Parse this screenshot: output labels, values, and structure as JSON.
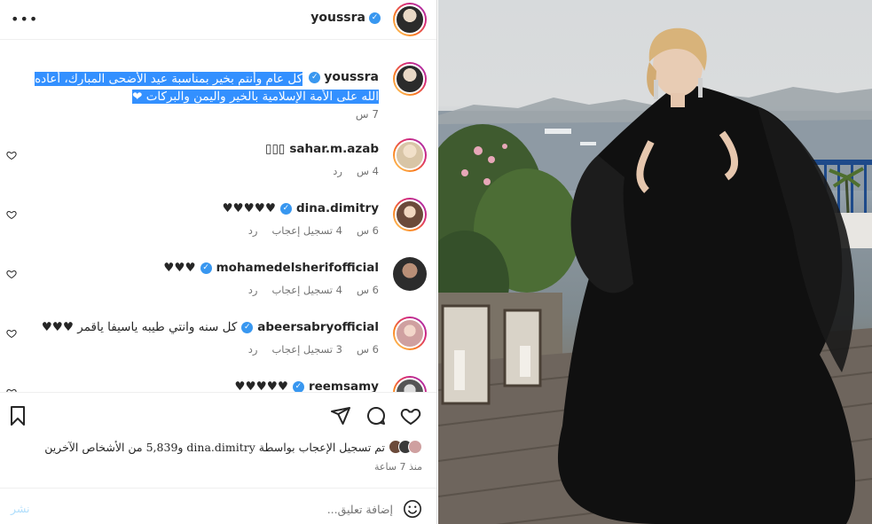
{
  "header": {
    "username": "youssra",
    "more_label": "•••"
  },
  "caption": {
    "username": "youssra",
    "text": "كل عام وأنتم بخير بمناسبة عيد الأضحى المبارك، أعاده الله على الأمة الإسلامية بالخير واليمن والبركات ❤",
    "time": "7 س"
  },
  "comments": [
    {
      "username": "sahar.m.azab",
      "text": "▯▯▯",
      "time": "4 س",
      "reply": "رد",
      "likes": ""
    },
    {
      "username": "dina.dimitry",
      "text": "♥♥♥♥♥",
      "time": "6 س",
      "likes": "4 تسجيل إعجاب",
      "reply": "رد"
    },
    {
      "username": "mohamedelsherifofficial",
      "text": "♥♥♥",
      "time": "6 س",
      "likes": "4 تسجيل إعجاب",
      "reply": "رد"
    },
    {
      "username": "abeersabryofficial",
      "text": "كل سنه وانتي طيبه ياسيفا ياقمر ♥♥♥",
      "time": "6 س",
      "likes": "3 تسجيل إعجاب",
      "reply": "رد"
    },
    {
      "username": "reemsamy",
      "text": "♥♥♥♥♥",
      "time": "",
      "likes": "",
      "reply": ""
    }
  ],
  "likes": {
    "text": "تم تسجيل الإعجاب بواسطة dina.dimitry و5,839 من الأشخاص الآخرين"
  },
  "time_ago": "منذ 7 ساعة",
  "composer": {
    "placeholder": "إضافة تعليق...",
    "post_label": "نشر"
  },
  "colors": {
    "accent": "#3897f0",
    "highlight": "#3390ff",
    "post_disabled": "#b2dffc"
  }
}
